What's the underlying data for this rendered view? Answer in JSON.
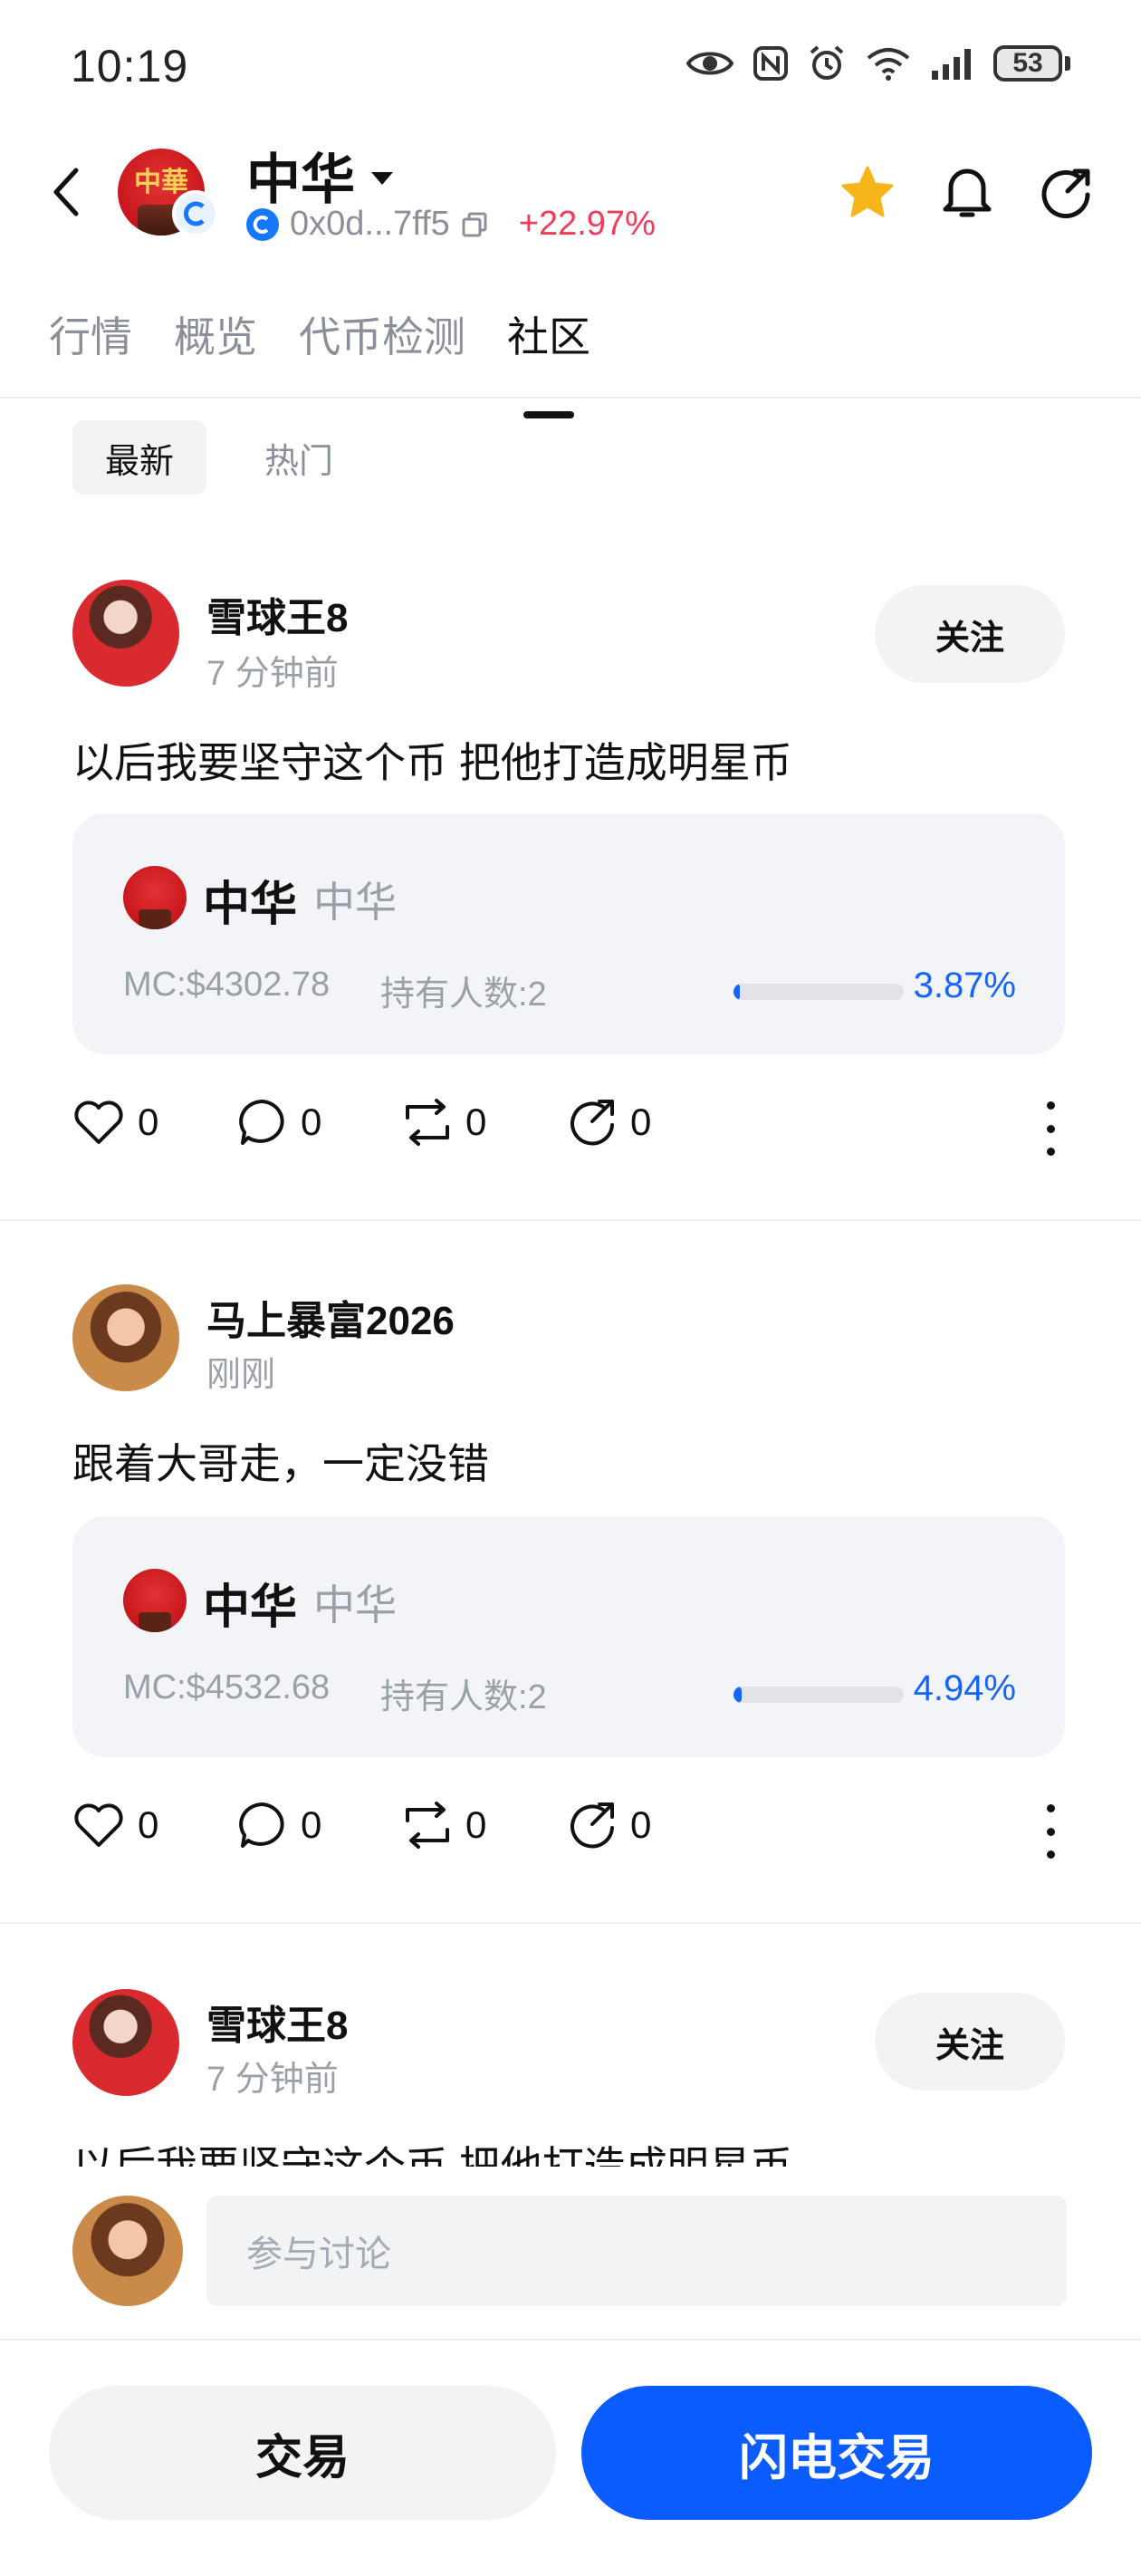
{
  "status_bar": {
    "time": "10:19",
    "battery": "53",
    "icons": [
      "eye-icon",
      "nfc-icon",
      "alarm-icon",
      "wifi-icon",
      "signal-icon",
      "battery-icon"
    ]
  },
  "header": {
    "token_name": "中华",
    "address": "0x0d...7ff5",
    "change": "+22.97%",
    "change_color": "#f23b5a",
    "icons": [
      "back-icon",
      "star-icon",
      "bell-icon",
      "share-icon"
    ],
    "star_color": "#f5b51b"
  },
  "tabs": [
    {
      "label": "行情",
      "active": false
    },
    {
      "label": "概览",
      "active": false
    },
    {
      "label": "代币检测",
      "active": false
    },
    {
      "label": "社区",
      "active": true
    }
  ],
  "filters": [
    {
      "label": "最新",
      "active": true
    },
    {
      "label": "热门",
      "active": false
    }
  ],
  "posts": [
    {
      "user": "雪球王8",
      "time": "7 分钟前",
      "follow_label": "关注",
      "text": "以后我要坚守这个币 把他打造成明星币",
      "token": {
        "name": "中华",
        "symbol": "中华",
        "mc": "MC:$4302.78",
        "holders": "持有人数:2",
        "progress_pct": "3.87%",
        "progress": 0.0387
      },
      "likes": "0",
      "comments": "0",
      "reposts": "0",
      "shares": "0"
    },
    {
      "user": "马上暴富2026",
      "time": "刚刚",
      "text": "跟着大哥走，一定没错",
      "token": {
        "name": "中华",
        "symbol": "中华",
        "mc": "MC:$4532.68",
        "holders": "持有人数:2",
        "progress_pct": "4.94%",
        "progress": 0.0494
      },
      "likes": "0",
      "comments": "0",
      "reposts": "0",
      "shares": "0"
    },
    {
      "user": "雪球王8",
      "time": "7 分钟前",
      "follow_label": "关注",
      "text": "以后我要坚守这个币 把他打造成明星币"
    }
  ],
  "comment_bar": {
    "placeholder": "参与讨论"
  },
  "bottom_bar": {
    "trade_label": "交易",
    "flash_trade_label": "闪电交易",
    "flash_color": "#0a5cff"
  },
  "colors": {
    "accent_blue": "#1464ff"
  }
}
